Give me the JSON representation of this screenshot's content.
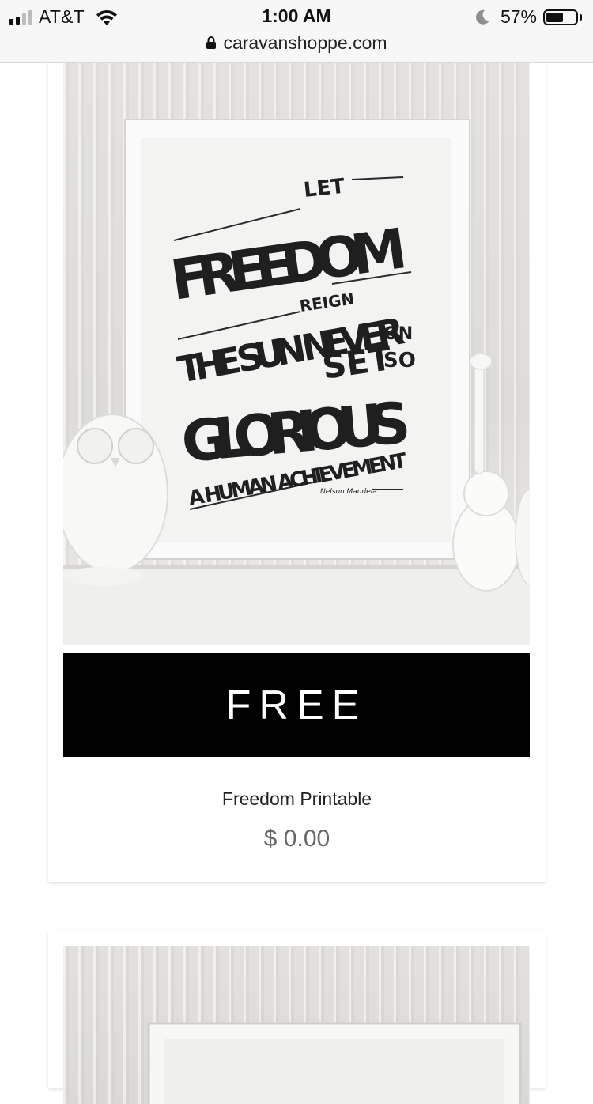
{
  "status_bar": {
    "carrier": "AT&T",
    "time": "1:00 AM",
    "battery_percent": "57%",
    "battery_level": 0.57,
    "signal_bars": 2
  },
  "url_bar": {
    "url": "caravanshoppe.com"
  },
  "product": {
    "image_alt": "Let freedom reign print",
    "poster_text": [
      "LET",
      "FREEDOM",
      "REIGN",
      "THE SUN NEVER",
      "SET",
      "ON",
      "SO",
      "GLORIOUS",
      "A HUMAN ACHIEVEMENT",
      "Nelson Mandela"
    ],
    "banner": "FREE",
    "title": "Freedom Printable",
    "price": "$ 0.00"
  },
  "colors": {
    "banner_bg": "#000000",
    "banner_text": "#ffffff",
    "price": "#666666"
  }
}
